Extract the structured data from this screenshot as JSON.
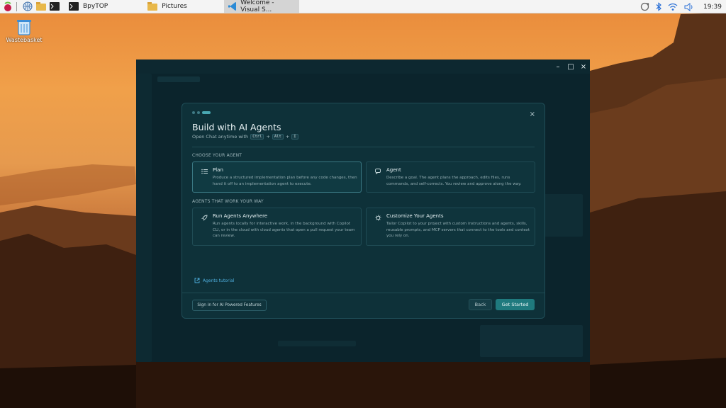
{
  "taskbar": {
    "tasks": [
      {
        "label": "BpyTOP",
        "icon": "terminal-icon"
      },
      {
        "label": "Pictures",
        "icon": "folder-icon"
      },
      {
        "label": "Welcome - Visual S...",
        "icon": "vscode-icon"
      }
    ],
    "clock": "19:39"
  },
  "desktop": {
    "wastebasket_label": "Wastebasket"
  },
  "dialog": {
    "title": "Build with AI Agents",
    "subtitle_prefix": "Open Chat anytime with",
    "shortcut_keys": [
      "Ctrl",
      "Alt",
      "I"
    ],
    "shortcut_plus": "+",
    "section_choose": "CHOOSE YOUR AGENT",
    "section_work": "AGENTS THAT WORK YOUR WAY",
    "cards": [
      {
        "title": "Plan",
        "desc": "Produce a structured implementation plan before any code changes, then hand it off to an implementation agent to execute.",
        "icon": "list-icon"
      },
      {
        "title": "Agent",
        "desc": "Describe a goal. The agent plans the approach, edits files, runs commands, and self-corrects. You review and approve along the way.",
        "icon": "chat-icon"
      },
      {
        "title": "Run Agents Anywhere",
        "desc": "Run agents locally for interactive work, in the background with Copilot CLI, or in the cloud with cloud agents that open a pull request your team can review.",
        "icon": "rocket-icon"
      },
      {
        "title": "Customize Your Agents",
        "desc": "Tailor Copilot to your project with custom instructions and agents, skills, reusable prompts, and MCP servers that connect to the tools and context you rely on.",
        "icon": "gear-icon"
      }
    ],
    "tutorial_link": "Agents tutorial",
    "signin_button": "Sign in for AI Powered Features",
    "back_button": "Back",
    "start_button": "Get Started",
    "close_symbol": "×"
  },
  "window_controls": {
    "minimize": "–",
    "maximize": "□",
    "close": "×"
  },
  "colors": {
    "accent": "#1f7a7e",
    "link": "#4fb0e0",
    "dialog_bg": "#0e3139"
  }
}
